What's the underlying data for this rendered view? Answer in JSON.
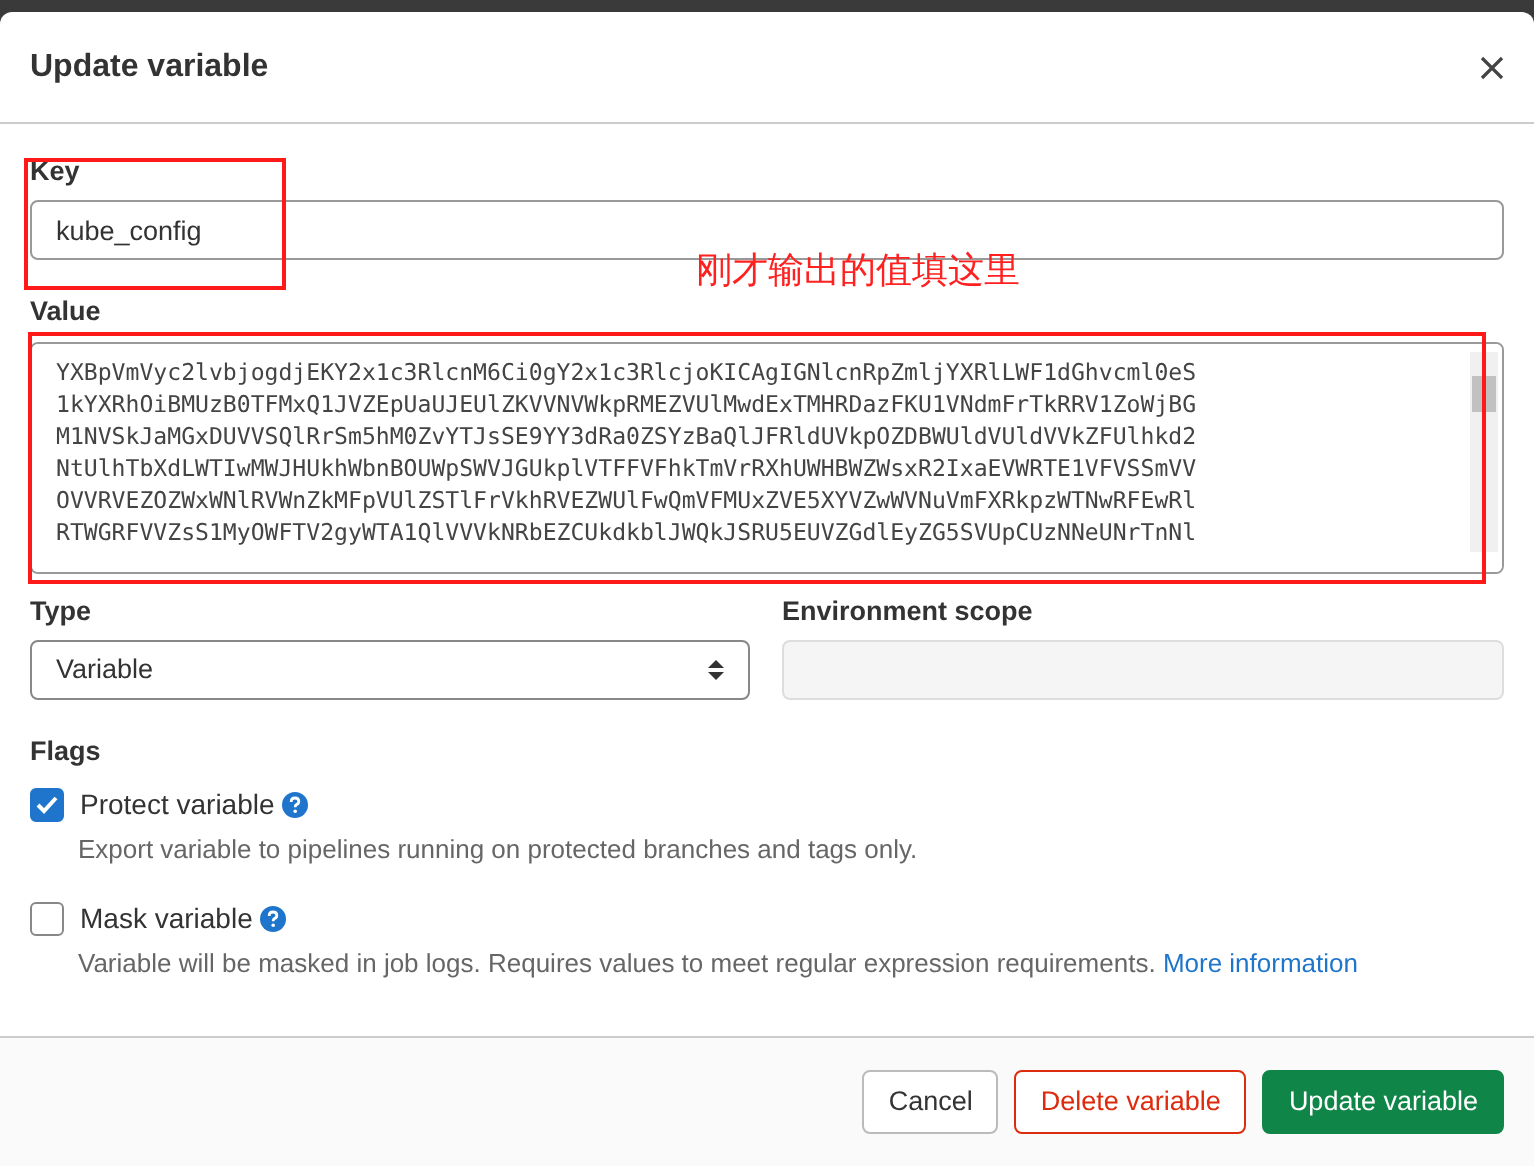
{
  "modal": {
    "title": "Update variable"
  },
  "key": {
    "label": "Key",
    "value": "kube_config"
  },
  "value": {
    "label": "Value",
    "lines": [
      "YXBpVmVyc2lvbjogdjEKY2x1c3RlcnM6Ci0gY2x1c3RlcjoKICAgIGNlcnRpZmljYXRlLWF1dGhvcml0eS",
      "1kYXRhOiBMUzB0TFMxQ1JVZEpUaUJEUlZKVVNVWkpRMEZVUlMwdExTMHRDazFKU1VNdmFrTkRRV1ZoWjBG",
      "M1NVSkJaMGxDUVVSQlRrSm5hM0ZvYTJsSE9YY3dRa0ZSYzBaQlJFRldUVkpOZDBWUldVUldVVkZFUlhkd2",
      "NtUlhTbXdLWTIwMWJHUkhWbnBOUWpSWVJGUkplVTFFVFhkTmVrRXhUWHBWZWsxR2IxaEVWRTE1VFVSSmVV",
      "OVVRVEZOZWxWNlRVWnZkMFpVUlZSTlFrVkhRVEZWUlFwQmVFMUxZVE5XYVZwWVNuVmFXRkpzWTNwRFEwRl",
      "RTWGRFVVZsS1MyOWFTV2gyWTA1QlVVVkNRbEZCUkdkblJWQkJSRU5EUVZGdlEyZG5SVUpCUzNNeUNrTnNl"
    ]
  },
  "type": {
    "label": "Type",
    "value": "Variable"
  },
  "environment_scope": {
    "label": "Environment scope",
    "disabled": true
  },
  "flags": {
    "label": "Flags",
    "items": [
      {
        "label": "Protect variable",
        "checked": true,
        "help": "Export variable to pipelines running on protected branches and tags only."
      },
      {
        "label": "Mask variable",
        "checked": false,
        "help": "Variable will be masked in job logs. Requires values to meet regular expression requirements.",
        "link": "More information"
      }
    ]
  },
  "buttons": [
    {
      "label": "Cancel",
      "kind": "secondary"
    },
    {
      "label": "Delete variable",
      "kind": "danger"
    },
    {
      "label": "Update variable",
      "kind": "primary"
    }
  ],
  "annotation": {
    "text": "刚才输出的值填这里"
  }
}
